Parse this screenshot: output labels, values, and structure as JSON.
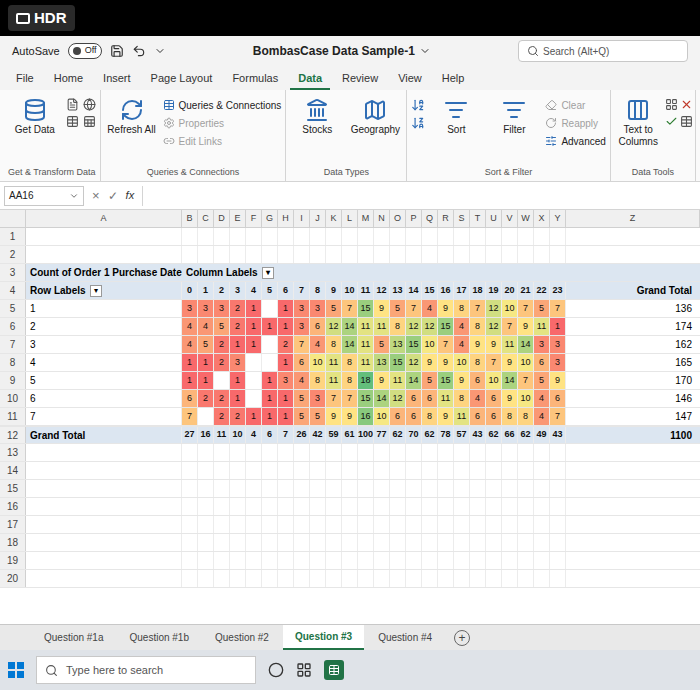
{
  "camera": {
    "badge": "HDR"
  },
  "window": {
    "autosave_label": "AutoSave",
    "autosave": {
      "label": "Off",
      "on": false
    },
    "title": "BombasCase Data Sample-1",
    "search": {
      "placeholder": "Search (Alt+Q)"
    }
  },
  "ribbon_tabs": [
    {
      "label": "File",
      "selected": false
    },
    {
      "label": "Home",
      "selected": false
    },
    {
      "label": "Insert",
      "selected": false
    },
    {
      "label": "Page Layout",
      "selected": false
    },
    {
      "label": "Formulas",
      "selected": false
    },
    {
      "label": "Data",
      "selected": true
    },
    {
      "label": "Review",
      "selected": false
    },
    {
      "label": "View",
      "selected": false
    },
    {
      "label": "Help",
      "selected": false
    }
  ],
  "ribbon": {
    "groups": [
      {
        "label": "Get & Transform Data",
        "items": [
          {
            "label": "Get Data",
            "kind": "large",
            "disabled": false
          }
        ]
      },
      {
        "label": "Queries & Connections",
        "items": [
          {
            "label": "Refresh All",
            "kind": "large",
            "disabled": false
          },
          {
            "label": "Queries & Connections",
            "kind": "small",
            "disabled": false
          },
          {
            "label": "Properties",
            "kind": "small",
            "disabled": true
          },
          {
            "label": "Edit Links",
            "kind": "small",
            "disabled": true
          }
        ]
      },
      {
        "label": "Data Types",
        "items": [
          {
            "label": "Stocks",
            "kind": "large",
            "disabled": false
          },
          {
            "label": "Geography",
            "kind": "large",
            "disabled": false
          }
        ]
      },
      {
        "label": "Sort & Filter",
        "items": [
          {
            "label": "Sort",
            "kind": "large",
            "disabled": false
          },
          {
            "label": "Filter",
            "kind": "large",
            "disabled": false
          },
          {
            "label": "Clear",
            "kind": "small",
            "disabled": true
          },
          {
            "label": "Reapply",
            "kind": "small",
            "disabled": true
          },
          {
            "label": "Advanced",
            "kind": "small",
            "disabled": false
          }
        ]
      },
      {
        "label": "Data Tools",
        "items": [
          {
            "label": "Text to Columns",
            "kind": "large",
            "disabled": false
          }
        ]
      }
    ]
  },
  "formula_bar": {
    "name_box": "AA16",
    "cancel": "×",
    "enter": "✓",
    "fx": "fx",
    "value": ""
  },
  "sheet": {
    "columns": [
      "A",
      "B",
      "C",
      "D",
      "E",
      "F",
      "G",
      "H",
      "I",
      "J",
      "K",
      "L",
      "M",
      "N",
      "O",
      "P",
      "Q",
      "R",
      "S",
      "T",
      "U",
      "V",
      "W",
      "X",
      "Y",
      "Z"
    ],
    "rows": [
      "1",
      "2",
      "3",
      "4",
      "5",
      "6",
      "7",
      "8",
      "9",
      "10",
      "11",
      "12",
      "13",
      "14",
      "15",
      "16",
      "17",
      "18",
      "19",
      "20"
    ]
  },
  "pivot": {
    "title": "Count of Order 1 Purchase Date",
    "column_labels": "Column Labels",
    "row_labels": "Row Labels",
    "filter_glyph": "▾",
    "grand_total_label": "Grand Total",
    "columns": [
      "0",
      "1",
      "2",
      "3",
      "4",
      "5",
      "6",
      "7",
      "8",
      "9",
      "10",
      "11",
      "12",
      "13",
      "14",
      "15",
      "16",
      "17",
      "18",
      "19",
      "20",
      "21",
      "22",
      "23"
    ],
    "rows": [
      {
        "label": "1",
        "values": [
          "3",
          "3",
          "3",
          "2",
          "1",
          "",
          "1",
          "3",
          "3",
          "5",
          "7",
          "15",
          "9",
          "5",
          "7",
          "4",
          "9",
          "8",
          "7",
          "12",
          "10",
          "7",
          "5",
          "7"
        ],
        "total": "136"
      },
      {
        "label": "2",
        "values": [
          "4",
          "4",
          "5",
          "2",
          "1",
          "1",
          "1",
          "3",
          "6",
          "12",
          "14",
          "11",
          "11",
          "8",
          "12",
          "12",
          "15",
          "4",
          "8",
          "12",
          "7",
          "9",
          "11",
          "1"
        ],
        "total": "174"
      },
      {
        "label": "3",
        "values": [
          "4",
          "5",
          "2",
          "1",
          "1",
          "",
          "2",
          "7",
          "4",
          "8",
          "14",
          "11",
          "5",
          "13",
          "15",
          "10",
          "7",
          "4",
          "9",
          "9",
          "11",
          "14",
          "3",
          "3"
        ],
        "total": "162"
      },
      {
        "label": "4",
        "values": [
          "1",
          "1",
          "2",
          "3",
          "",
          "",
          "1",
          "6",
          "10",
          "11",
          "8",
          "11",
          "13",
          "15",
          "12",
          "9",
          "9",
          "10",
          "8",
          "7",
          "9",
          "10",
          "6",
          "3"
        ],
        "total": "165"
      },
      {
        "label": "5",
        "values": [
          "1",
          "1",
          "",
          "1",
          "",
          "1",
          "3",
          "4",
          "8",
          "11",
          "8",
          "18",
          "9",
          "11",
          "14",
          "5",
          "15",
          "9",
          "6",
          "10",
          "14",
          "7",
          "5",
          "9"
        ],
        "total": "170"
      },
      {
        "label": "6",
        "values": [
          "6",
          "2",
          "2",
          "1",
          "",
          "1",
          "1",
          "5",
          "3",
          "7",
          "7",
          "15",
          "14",
          "12",
          "6",
          "6",
          "11",
          "8",
          "4",
          "6",
          "9",
          "10",
          "4",
          "6"
        ],
        "total": "146"
      },
      {
        "label": "7",
        "values": [
          "7",
          "",
          "2",
          "2",
          "1",
          "1",
          "1",
          "5",
          "5",
          "9",
          "9",
          "16",
          "10",
          "6",
          "6",
          "8",
          "9",
          "11",
          "6",
          "6",
          "8",
          "8",
          "4",
          "7"
        ],
        "total": "147"
      }
    ],
    "grand_total": {
      "label": "Grand Total",
      "values": [
        "27",
        "16",
        "11",
        "10",
        "4",
        "6",
        "7",
        "26",
        "42",
        "59",
        "61",
        "100",
        "77",
        "62",
        "70",
        "62",
        "78",
        "57",
        "43",
        "62",
        "66",
        "62",
        "49",
        "43"
      ],
      "total": "1100"
    }
  },
  "sheet_tabs": [
    {
      "label": "Question #1a",
      "selected": false
    },
    {
      "label": "Question #1b",
      "selected": false
    },
    {
      "label": "Question #2",
      "selected": false
    },
    {
      "label": "Question #3",
      "selected": true
    },
    {
      "label": "Question #4",
      "selected": false
    }
  ],
  "add_sheet": "+",
  "taskbar": {
    "search_placeholder": "Type here to search"
  }
}
